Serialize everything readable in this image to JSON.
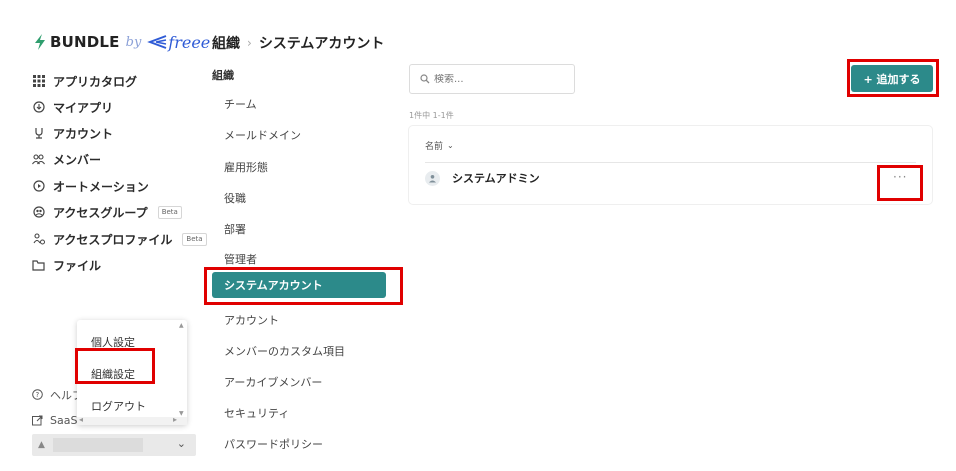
{
  "logo": {
    "brand": "BUNDLE",
    "by": "by",
    "partner": "freee"
  },
  "sidebar": {
    "items": [
      {
        "label": "アプリカタログ",
        "icon": "grid-icon"
      },
      {
        "label": "マイアプリ",
        "icon": "circle-arrow-icon"
      },
      {
        "label": "アカウント",
        "icon": "person-icon"
      },
      {
        "label": "メンバー",
        "icon": "people-icon"
      },
      {
        "label": "オートメーション",
        "icon": "play-circle-icon"
      },
      {
        "label": "アクセスグループ",
        "icon": "group-circle-icon",
        "badge": "Beta"
      },
      {
        "label": "アクセスプロファイル",
        "icon": "profile-icon",
        "badge": "Beta"
      },
      {
        "label": "ファイル",
        "icon": "folder-icon"
      }
    ],
    "help_label": "ヘルプ",
    "saas_label": "SaaSt"
  },
  "user_menu": {
    "items": [
      "個人設定",
      "組織設定",
      "ログアウト"
    ]
  },
  "breadcrumb": {
    "parent": "組織",
    "separator": "›",
    "current": "システムアカウント"
  },
  "org_nav": {
    "title": "組織",
    "items": [
      "チーム",
      "メールドメイン",
      "雇用形態",
      "役職",
      "部署",
      "管理者"
    ],
    "active": "システムアカウント",
    "items_after": [
      "アカウント",
      "メンバーのカスタム項目",
      "アーカイブメンバー",
      "セキュリティ",
      "パスワードポリシー"
    ]
  },
  "content": {
    "search_placeholder": "検索...",
    "count_text": "1件中 1-1件",
    "add_button": "+ 追加する",
    "column_name": "名前",
    "rows": [
      {
        "name": "システムアドミン"
      }
    ],
    "more_label": "···"
  },
  "colors": {
    "accent": "#2c8a8a",
    "highlight": "#e00000",
    "freee_blue": "#2f5bd6"
  }
}
